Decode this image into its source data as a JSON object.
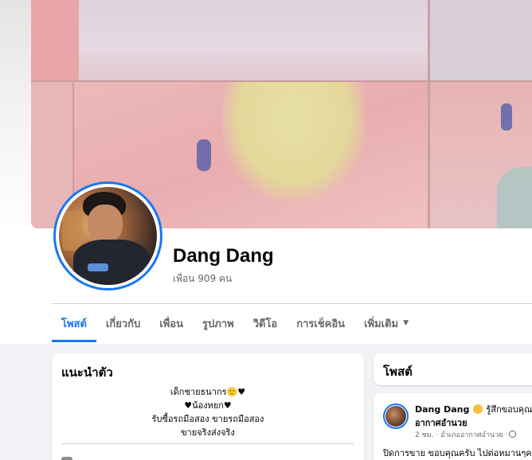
{
  "profile": {
    "name": "Dang Dang",
    "friends_count": "เพื่อน 909 คน"
  },
  "tabs": [
    {
      "label": "โพสต์",
      "active": true
    },
    {
      "label": "เกี่ยวกับ",
      "active": false
    },
    {
      "label": "เพื่อน",
      "active": false
    },
    {
      "label": "รูปภาพ",
      "active": false
    },
    {
      "label": "วิดีโอ",
      "active": false
    },
    {
      "label": "การเช็คอิน",
      "active": false
    },
    {
      "label": "เพิ่มเติม",
      "active": false,
      "icon": "chevron-down-icon"
    }
  ],
  "intro": {
    "title": "แนะนำตัว",
    "bio_lines": [
      "เด็กชายธนากร🙂♥",
      "♥น้องหยก♥",
      "รับซื้อรถมือสอง ขายรถมือสอง",
      "ขายจริงส่งจริง"
    ]
  },
  "posts_section": {
    "title": "โพสต์"
  },
  "post": {
    "author": "Dang Dang",
    "feeling": "รู้สึกขอบคุณกับ",
    "emoji_icon": "grinning-face-icon",
    "place": "อากาศอำนวย",
    "meta": "2 ชม. · อำเภออากาศอำนวย ·",
    "privacy_icon": "globe-icon",
    "text": "ปิดการขาย ขอบคุณครับ ไปต่อหมานๆค"
  },
  "colors": {
    "accent": "#1877f2",
    "secondary_text": "#65676b",
    "page_bg": "#f0f2f5"
  }
}
